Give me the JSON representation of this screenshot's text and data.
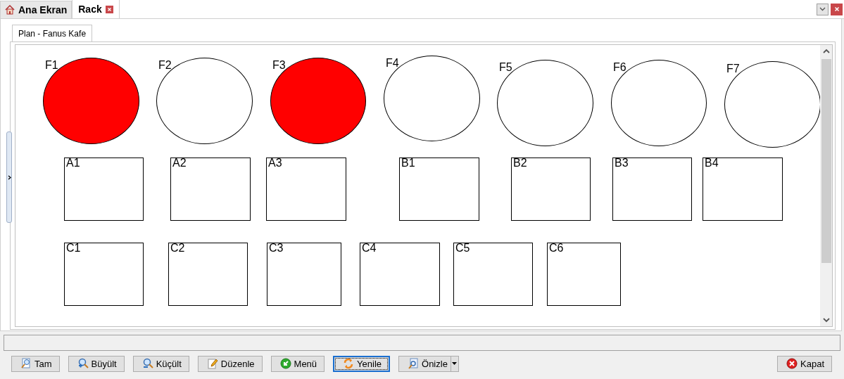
{
  "tabs": [
    {
      "label": "Ana Ekran",
      "selected": false,
      "kind": "home"
    },
    {
      "label": "Rack",
      "selected": true,
      "kind": "closable"
    }
  ],
  "plan_tab": {
    "label": "Plan - Fanus Kafe",
    "selected": true
  },
  "tables": [
    {
      "label": "F1",
      "kind": "round",
      "occupied": true
    },
    {
      "label": "F2",
      "kind": "round",
      "occupied": false
    },
    {
      "label": "F3",
      "kind": "round",
      "occupied": true
    },
    {
      "label": "F4",
      "kind": "round",
      "occupied": false
    },
    {
      "label": "F5",
      "kind": "round",
      "occupied": false
    },
    {
      "label": "F6",
      "kind": "round",
      "occupied": false
    },
    {
      "label": "F7",
      "kind": "round",
      "occupied": false
    },
    {
      "label": "A1",
      "kind": "square",
      "occupied": false
    },
    {
      "label": "A2",
      "kind": "square",
      "occupied": false
    },
    {
      "label": "A3",
      "kind": "square",
      "occupied": false
    },
    {
      "label": "B1",
      "kind": "square",
      "occupied": false
    },
    {
      "label": "B2",
      "kind": "square",
      "occupied": false
    },
    {
      "label": "B3",
      "kind": "square",
      "occupied": false
    },
    {
      "label": "B4",
      "kind": "square",
      "occupied": false
    },
    {
      "label": "C1",
      "kind": "square",
      "occupied": false
    },
    {
      "label": "C2",
      "kind": "square",
      "occupied": false
    },
    {
      "label": "C3",
      "kind": "square",
      "occupied": false
    },
    {
      "label": "C4",
      "kind": "square",
      "occupied": false
    },
    {
      "label": "C5",
      "kind": "square",
      "occupied": false
    },
    {
      "label": "C6",
      "kind": "square",
      "occupied": false
    }
  ],
  "buttons": [
    {
      "label": "Tam",
      "kind": "zoom-fit",
      "focused": false
    },
    {
      "label": "Büyült",
      "kind": "zoom-in",
      "focused": false
    },
    {
      "label": "Küçült",
      "kind": "zoom-out",
      "focused": false
    },
    {
      "label": "Düzenle",
      "kind": "edit",
      "focused": false
    },
    {
      "label": "Menü",
      "kind": "menu",
      "focused": false
    },
    {
      "label": "Yenile",
      "kind": "refresh",
      "focused": true
    },
    {
      "label": "Önizle",
      "kind": "preview",
      "focused": false,
      "dropdown": true
    }
  ],
  "close_button": {
    "label": "Kapat"
  }
}
